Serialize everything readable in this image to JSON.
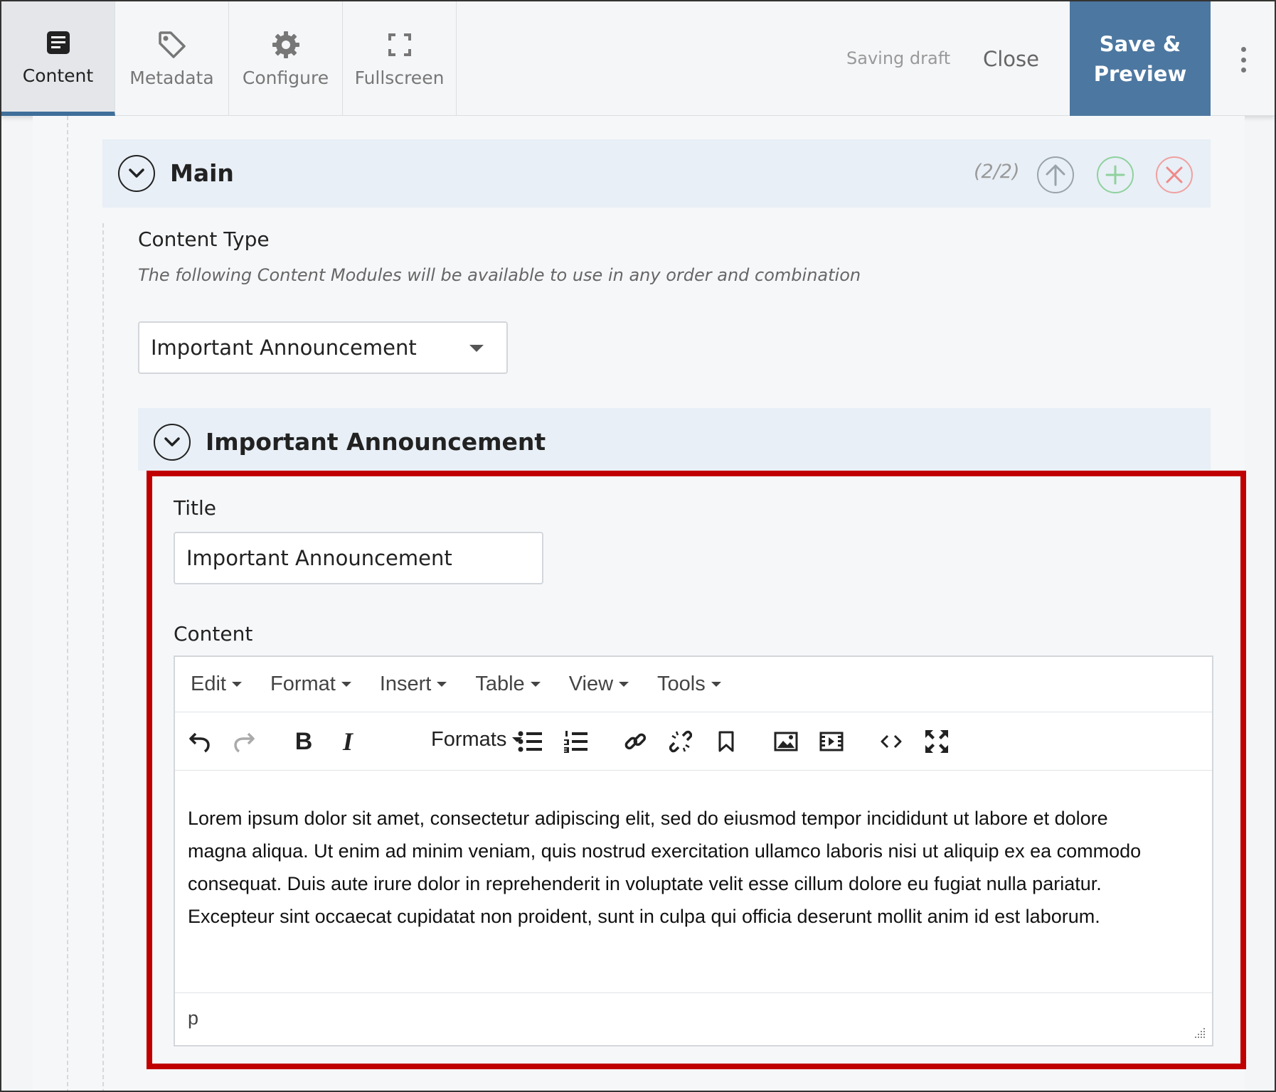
{
  "toolbar": {
    "tabs": [
      {
        "label": "Content",
        "icon": "document-icon",
        "active": true
      },
      {
        "label": "Metadata",
        "icon": "tag-icon",
        "active": false
      },
      {
        "label": "Configure",
        "icon": "gear-icon",
        "active": false
      },
      {
        "label": "Fullscreen",
        "icon": "fullscreen-icon",
        "active": false
      }
    ],
    "status": "Saving draft",
    "close_label": "Close",
    "save_label_line1": "Save &",
    "save_label_line2": "Preview",
    "menu_icon": "kebab-menu-icon"
  },
  "main_section": {
    "title": "Main",
    "counter": "(2/2)",
    "actions": [
      "move-up-icon",
      "add-icon",
      "remove-icon"
    ],
    "action_colors": {
      "up": "#9aa3ab",
      "add": "#8fd19e",
      "remove": "#f0a0a0"
    }
  },
  "content_type": {
    "label": "Content Type",
    "help": "The following Content Modules will be available to use in any order and combination",
    "selected": "Important Announcement"
  },
  "module": {
    "title": "Important Announcement",
    "title_field_label": "Title",
    "title_field_value": "Important Announcement",
    "content_field_label": "Content"
  },
  "editor": {
    "menus": [
      "Edit",
      "Format",
      "Insert",
      "Table",
      "View",
      "Tools"
    ],
    "formats_label": "Formats",
    "toolbar_icons": [
      "undo-icon",
      "redo-icon",
      "bold-icon",
      "italic-icon",
      "bullet-list-icon",
      "numbered-list-icon",
      "link-icon",
      "unlink-icon",
      "bookmark-icon",
      "image-icon",
      "media-icon",
      "code-icon",
      "fullscreen-icon"
    ],
    "body_lines": [
      "Lorem ipsum dolor sit amet, consectetur adipiscing elit, sed do eiusmod tempor incididunt ut labore et dolore",
      "magna aliqua. Ut enim ad minim veniam, quis nostrud exercitation ullamco laboris nisi ut aliquip ex ea commodo",
      "consequat. Duis aute irure dolor in reprehenderit in voluptate velit esse cillum dolore eu fugiat nulla pariatur.",
      "Excepteur sint occaecat cupidatat non proident, sunt in culpa qui officia deserunt mollit anim id est laborum."
    ],
    "path": "p"
  },
  "colors": {
    "accent": "#4c77a0",
    "highlight": "#c00000",
    "section_header": "#e8eff6"
  }
}
